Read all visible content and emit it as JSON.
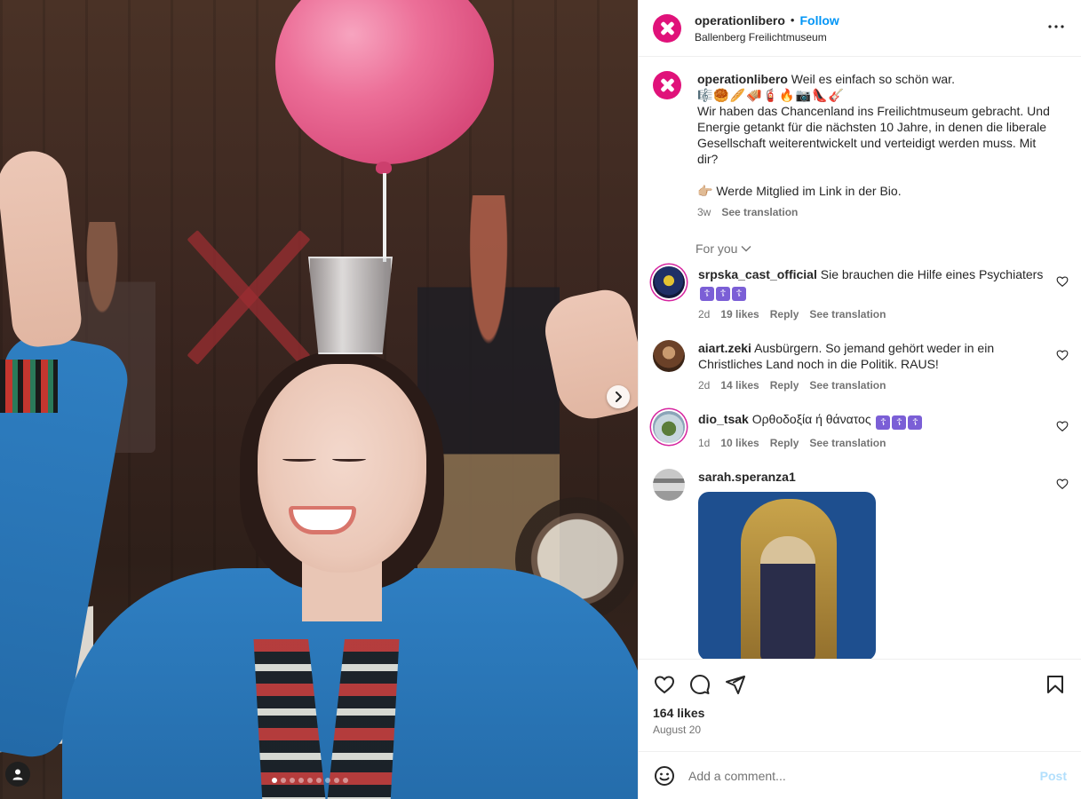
{
  "post": {
    "username": "operationlibero",
    "follow_label": "Follow",
    "separator": "•",
    "location": "Ballenberg Freilichtmuseum"
  },
  "caption": {
    "username": "operationlibero",
    "first_line": "Weil es einfach so schön war.",
    "emojis": "🎼🥮🥖🪗🧯🔥📷👠🎸",
    "paragraph": "Wir haben das Chancenland ins Freilichtmuseum gebracht. Und Energie getankt für die nächsten 10 Jahre, in denen die liberale Gesellschaft weiterentwickelt und verteidigt werden muss. Mit dir?",
    "cta": "👉🏼 Werde Mitglied im Link in der Bio.",
    "time": "3w",
    "translate": "See translation"
  },
  "for_you_label": "For you",
  "comments": [
    {
      "username": "srpska_cast_official",
      "text": "Sie brauchen die Hilfe eines Psychiaters",
      "symbols": [
        "☦",
        "☦",
        "☦"
      ],
      "time": "2d",
      "likes": "19 likes",
      "reply": "Reply",
      "translate": "See translation"
    },
    {
      "username": "aiart.zeki",
      "text": "Ausbürgern. So jemand gehört weder in ein Christliches Land noch in die Politik. RAUS!",
      "time": "2d",
      "likes": "14 likes",
      "reply": "Reply",
      "translate": "See translation"
    },
    {
      "username": "dio_tsak",
      "text": "Ορθοδοξία ή θάνατος",
      "symbols": [
        "☦",
        "☦",
        "☦"
      ],
      "time": "1d",
      "likes": "10 likes",
      "reply": "Reply",
      "translate": "See translation"
    },
    {
      "username": "sarah.speranza1"
    }
  ],
  "footer": {
    "likes": "164 likes",
    "date": "August 20"
  },
  "composer": {
    "placeholder": "Add a comment...",
    "post_label": "Post"
  },
  "carousel": {
    "slide_count": 9,
    "active_index": 0
  },
  "colors": {
    "brand": "#e0127a",
    "follow": "#0095f6",
    "post_disabled": "#b2dffc"
  },
  "icons": {
    "like": "heart-icon",
    "comment": "comment-icon",
    "share": "send-icon",
    "save": "bookmark-icon",
    "more": "more-options-icon",
    "emoji": "emoji-icon",
    "next": "chevron-right-icon",
    "tags": "user-tag-icon"
  }
}
